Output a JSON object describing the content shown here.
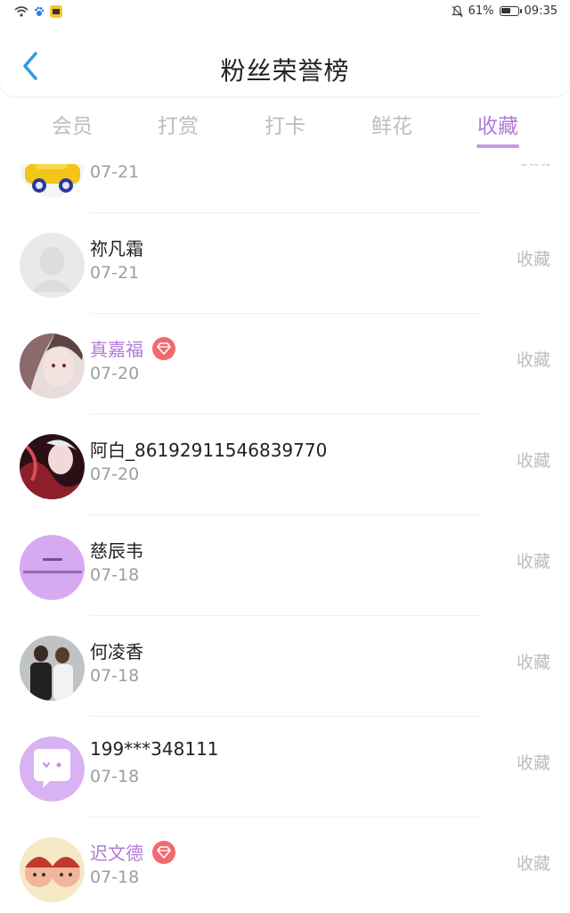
{
  "status": {
    "battery": "61%",
    "battery_level": 0.61,
    "time": "09:35"
  },
  "header": {
    "title": "粉丝荣誉榜"
  },
  "tabs": [
    {
      "label": "会员",
      "active": false
    },
    {
      "label": "打赏",
      "active": false
    },
    {
      "label": "打卡",
      "active": false
    },
    {
      "label": "鲜花",
      "active": false
    },
    {
      "label": "收藏",
      "active": true
    }
  ],
  "rows": [
    {
      "name": "",
      "date": "07-21",
      "action": "收藏",
      "vip": false,
      "avatar": "yellow-toy-car-avatar"
    },
    {
      "name": "祢凡霜",
      "date": "07-21",
      "action": "收藏",
      "vip": false,
      "avatar": "default-person-avatar"
    },
    {
      "name": "真嘉福",
      "date": "07-20",
      "action": "收藏",
      "vip": true,
      "avatar": "anime-girl-avatar"
    },
    {
      "name": "阿白_86192911546839770",
      "date": "07-20",
      "action": "收藏",
      "vip": false,
      "avatar": "anime-character-red-avatar"
    },
    {
      "name": "慈辰韦",
      "date": "07-18",
      "action": "收藏",
      "vip": false,
      "avatar": "purple-text-avatar"
    },
    {
      "name": "何凌香",
      "date": "07-18",
      "action": "收藏",
      "vip": false,
      "avatar": "couple-photo-avatar"
    },
    {
      "name": "199***348111",
      "date": "07-18",
      "action": "收藏",
      "vip": false,
      "avatar": "purple-chat-bubble-avatar"
    },
    {
      "name": "迟文德",
      "date": "07-18",
      "action": "收藏",
      "vip": true,
      "avatar": "cartoon-faces-avatar"
    }
  ],
  "colors": {
    "accent": "#b27ad8",
    "vip_badge": "#f06a6e",
    "back_arrow": "#2d9cdb"
  }
}
